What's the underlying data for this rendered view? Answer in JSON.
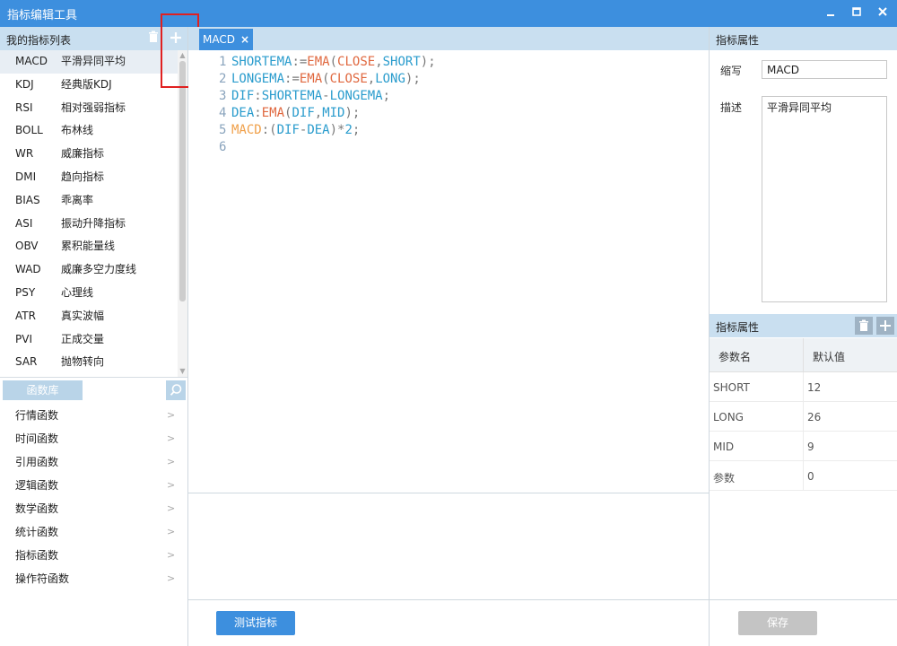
{
  "window": {
    "title": "指标编辑工具",
    "minimize_icon": "minimize-icon",
    "maximize_icon": "maximize-icon",
    "close_icon": "close-icon"
  },
  "indicator_list": {
    "header": "我的指标列表",
    "items": [
      {
        "code": "MACD",
        "name": "平滑异同平均",
        "selected": true
      },
      {
        "code": "KDJ",
        "name": "经典版KDJ"
      },
      {
        "code": "RSI",
        "name": "相对强弱指标"
      },
      {
        "code": "BOLL",
        "name": "布林线"
      },
      {
        "code": "WR",
        "name": "威廉指标"
      },
      {
        "code": "DMI",
        "name": "趋向指标"
      },
      {
        "code": "BIAS",
        "name": "乖离率"
      },
      {
        "code": "ASI",
        "name": "振动升降指标"
      },
      {
        "code": "OBV",
        "name": "累积能量线"
      },
      {
        "code": "WAD",
        "name": "威廉多空力度线"
      },
      {
        "code": "PSY",
        "name": "心理线"
      },
      {
        "code": "ATR",
        "name": "真实波幅"
      },
      {
        "code": "PVI",
        "name": "正成交量"
      },
      {
        "code": "SAR",
        "name": "抛物转向"
      }
    ]
  },
  "function_library": {
    "tab": "函数库",
    "items": [
      "行情函数",
      "时间函数",
      "引用函数",
      "逻辑函数",
      "数学函数",
      "统计函数",
      "指标函数",
      "操作符函数"
    ]
  },
  "editor": {
    "tab": "MACD",
    "tab_close": "×",
    "lines": [
      {
        "n": "1",
        "parts": [
          {
            "t": "SHORTEMA",
            "c": "var"
          },
          {
            "t": ":=",
            "c": "op"
          },
          {
            "t": "EMA",
            "c": "fn"
          },
          {
            "t": "(",
            "c": "op"
          },
          {
            "t": "CLOSE",
            "c": "fn"
          },
          {
            "t": ",",
            "c": "op"
          },
          {
            "t": "SHORT",
            "c": "var"
          },
          {
            "t": ");",
            "c": "op"
          }
        ]
      },
      {
        "n": "2",
        "parts": [
          {
            "t": "LONGEMA",
            "c": "var"
          },
          {
            "t": ":=",
            "c": "op"
          },
          {
            "t": "EMA",
            "c": "fn"
          },
          {
            "t": "(",
            "c": "op"
          },
          {
            "t": "CLOSE",
            "c": "fn"
          },
          {
            "t": ",",
            "c": "op"
          },
          {
            "t": "LONG",
            "c": "var"
          },
          {
            "t": ");",
            "c": "op"
          }
        ]
      },
      {
        "n": "3",
        "parts": [
          {
            "t": "DIF",
            "c": "var"
          },
          {
            "t": ":",
            "c": "op"
          },
          {
            "t": "SHORTEMA",
            "c": "var"
          },
          {
            "t": "-",
            "c": "op"
          },
          {
            "t": "LONGEMA",
            "c": "var"
          },
          {
            "t": ";",
            "c": "op"
          }
        ]
      },
      {
        "n": "4",
        "parts": [
          {
            "t": "DEA",
            "c": "var"
          },
          {
            "t": ":",
            "c": "op"
          },
          {
            "t": "EMA",
            "c": "fn"
          },
          {
            "t": "(",
            "c": "op"
          },
          {
            "t": "DIF",
            "c": "var"
          },
          {
            "t": ",",
            "c": "op"
          },
          {
            "t": "MID",
            "c": "var"
          },
          {
            "t": ");",
            "c": "op"
          }
        ]
      },
      {
        "n": "5",
        "parts": [
          {
            "t": "MACD",
            "c": "draw"
          },
          {
            "t": ":",
            "c": "op"
          },
          {
            "t": "(",
            "c": "op"
          },
          {
            "t": "DIF",
            "c": "var"
          },
          {
            "t": "-",
            "c": "op"
          },
          {
            "t": "DEA",
            "c": "var"
          },
          {
            "t": ")*",
            "c": "op"
          },
          {
            "t": "2",
            "c": "num"
          },
          {
            "t": ";",
            "c": "op"
          }
        ]
      },
      {
        "n": "6",
        "parts": []
      }
    ],
    "test_button": "测试指标"
  },
  "properties": {
    "header": "指标属性",
    "abbr_label": "缩写",
    "abbr_value": "MACD",
    "desc_label": "描述",
    "desc_value": "平滑异同平均"
  },
  "params": {
    "header": "指标属性",
    "col_name": "参数名",
    "col_default": "默认值",
    "rows": [
      {
        "name": "SHORT",
        "value": "12"
      },
      {
        "name": "LONG",
        "value": "26"
      },
      {
        "name": "MID",
        "value": "9"
      },
      {
        "name": "参数",
        "value": "0"
      }
    ],
    "save_button": "保存"
  },
  "colors": {
    "accent": "#3d8fde",
    "panel_header": "#c9dff0",
    "highlight": "#e02020"
  }
}
